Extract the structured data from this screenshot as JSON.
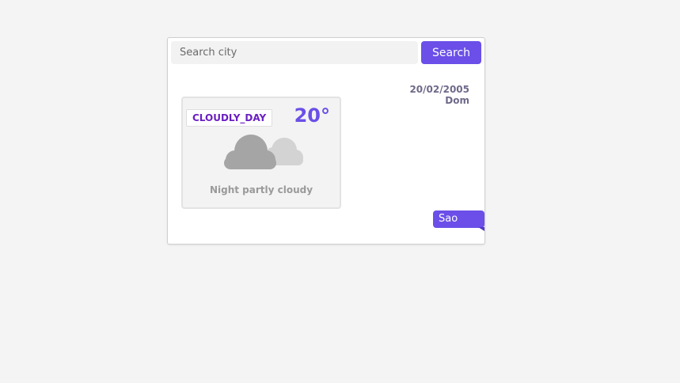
{
  "search": {
    "placeholder": "Search city",
    "button_label": "Search"
  },
  "date": {
    "value": "20/02/2005",
    "weekday": "Dom"
  },
  "weather": {
    "condition": "CLOUDLY_DAY",
    "temperature": "20°",
    "description": "Night partly cloudy",
    "icon": "cloud-icon"
  },
  "city": {
    "name": "Sao Paulo"
  },
  "colors": {
    "accent": "#6b4fe8",
    "condition_text": "#6a1fc2",
    "background": "#f4f4f4"
  }
}
